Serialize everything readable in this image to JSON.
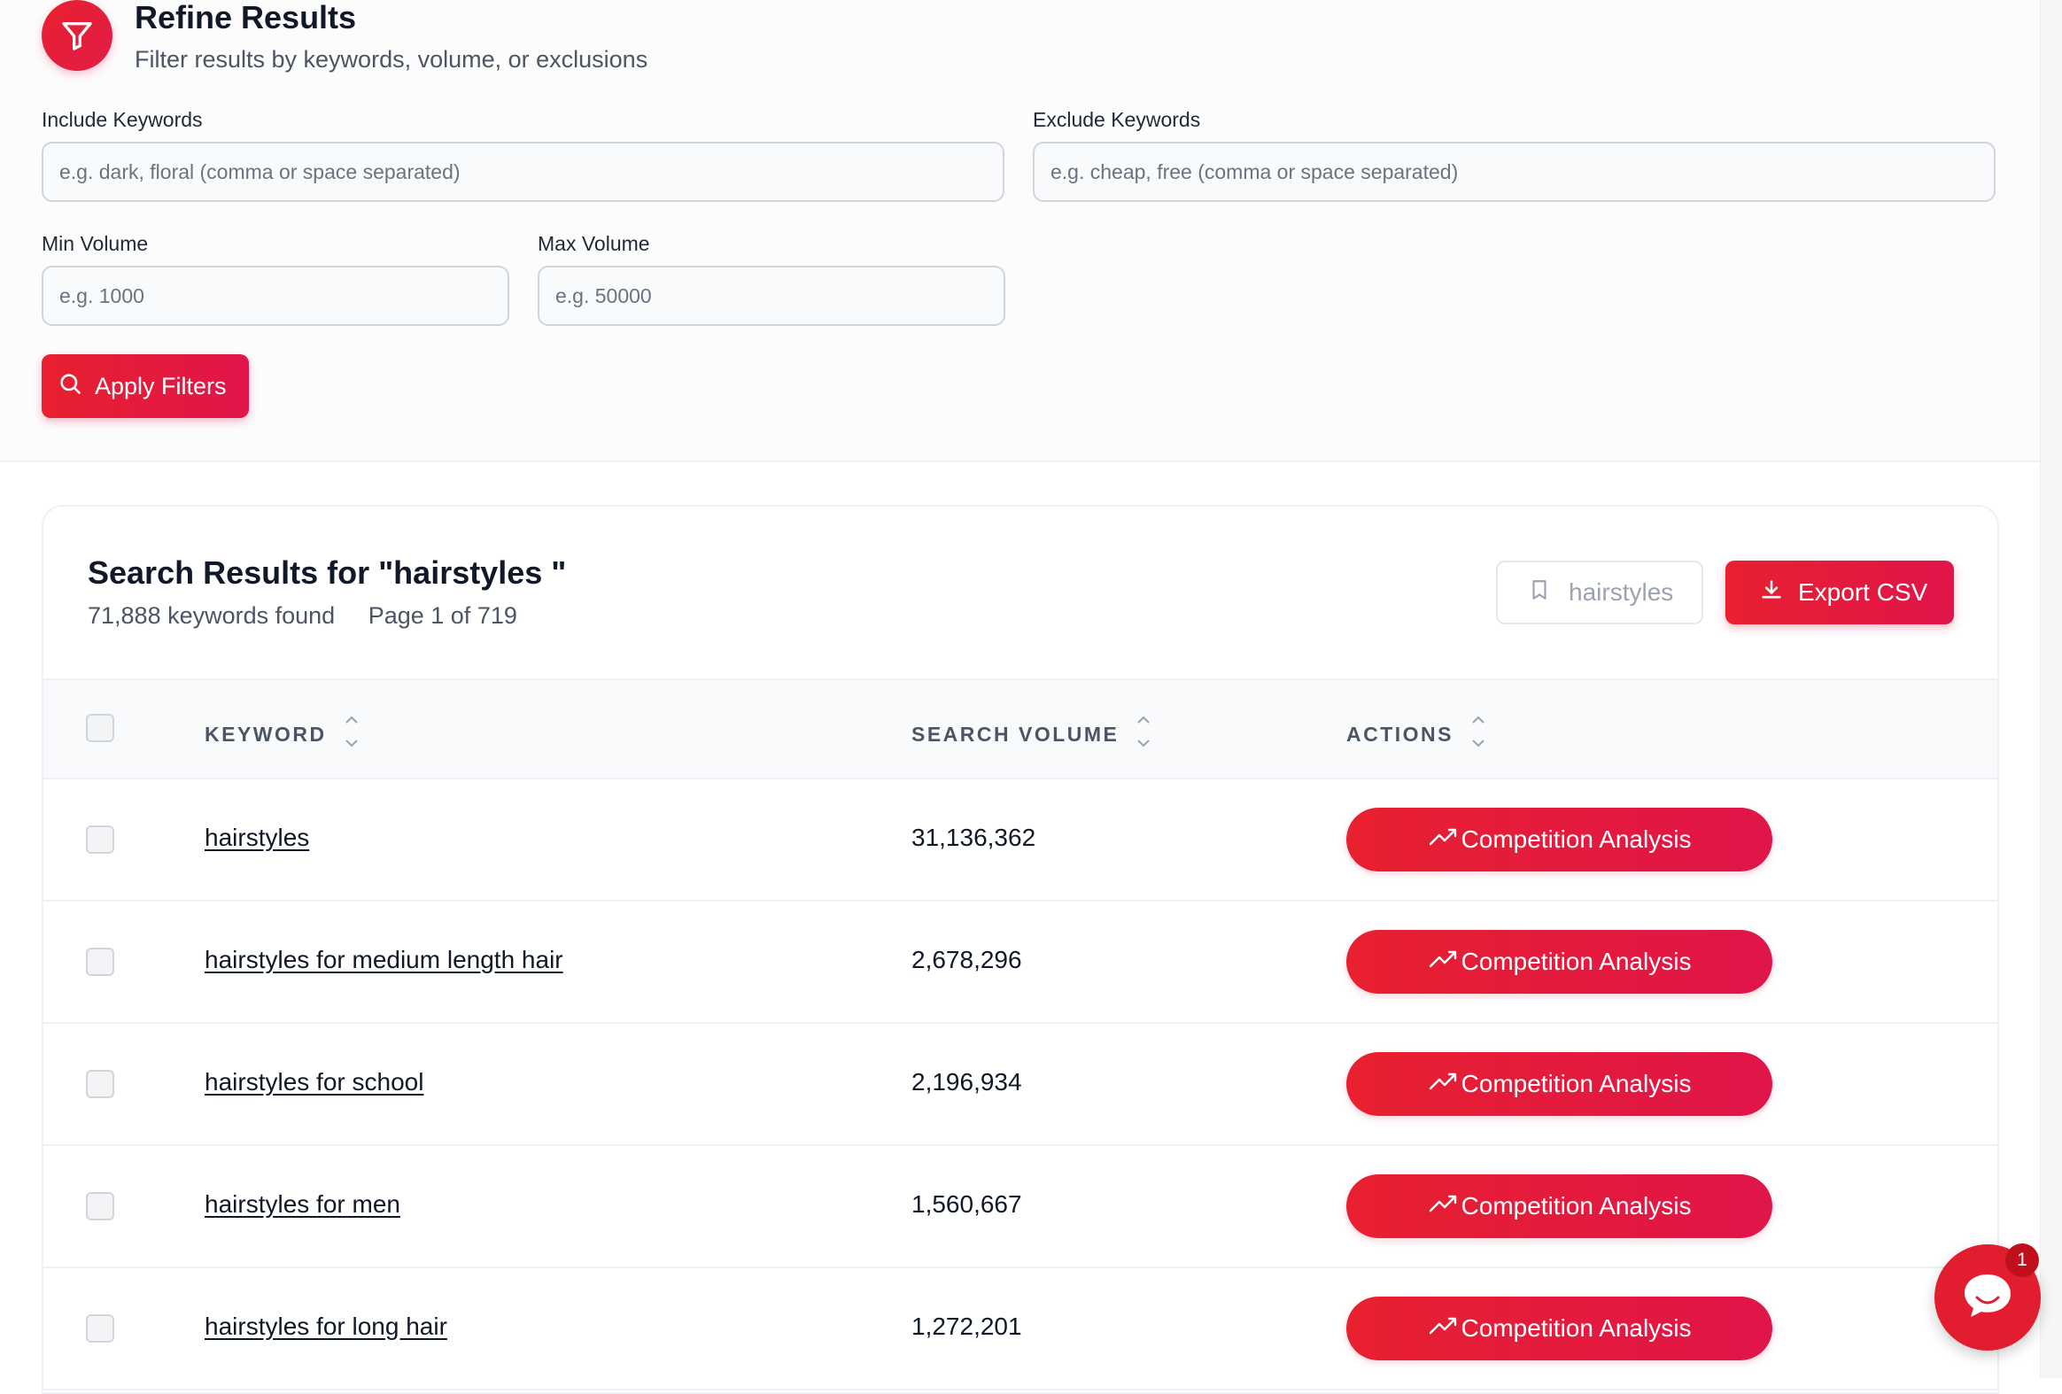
{
  "refine": {
    "title": "Refine Results",
    "subtitle": "Filter results by keywords, volume, or exclusions",
    "include_label": "Include Keywords",
    "include_placeholder": "e.g. dark, floral (comma or space separated)",
    "exclude_label": "Exclude Keywords",
    "exclude_placeholder": "e.g. cheap, free (comma or space separated)",
    "min_label": "Min Volume",
    "min_placeholder": "e.g. 1000",
    "max_label": "Max Volume",
    "max_placeholder": "e.g. 50000",
    "apply_label": "Apply Filters"
  },
  "results": {
    "title": "Search Results for \"hairstyles \"",
    "count_text": "71,888 keywords found",
    "page_text": "Page 1 of 719",
    "saved_label": "hairstyles",
    "export_label": "Export CSV",
    "columns": {
      "keyword": "KEYWORD",
      "volume": "SEARCH VOLUME",
      "actions": "ACTIONS"
    },
    "action_label": "Competition Analysis",
    "rows": [
      {
        "keyword": "hairstyles",
        "volume": "31,136,362"
      },
      {
        "keyword": "hairstyles for medium length hair",
        "volume": "2,678,296"
      },
      {
        "keyword": "hairstyles for school",
        "volume": "2,196,934"
      },
      {
        "keyword": "hairstyles for men",
        "volume": "1,560,667"
      },
      {
        "keyword": "hairstyles for long hair",
        "volume": "1,272,201"
      }
    ]
  },
  "chat": {
    "badge_count": "1"
  },
  "colors": {
    "accent": "#e11d2f",
    "accent_alt": "#e0154a"
  }
}
